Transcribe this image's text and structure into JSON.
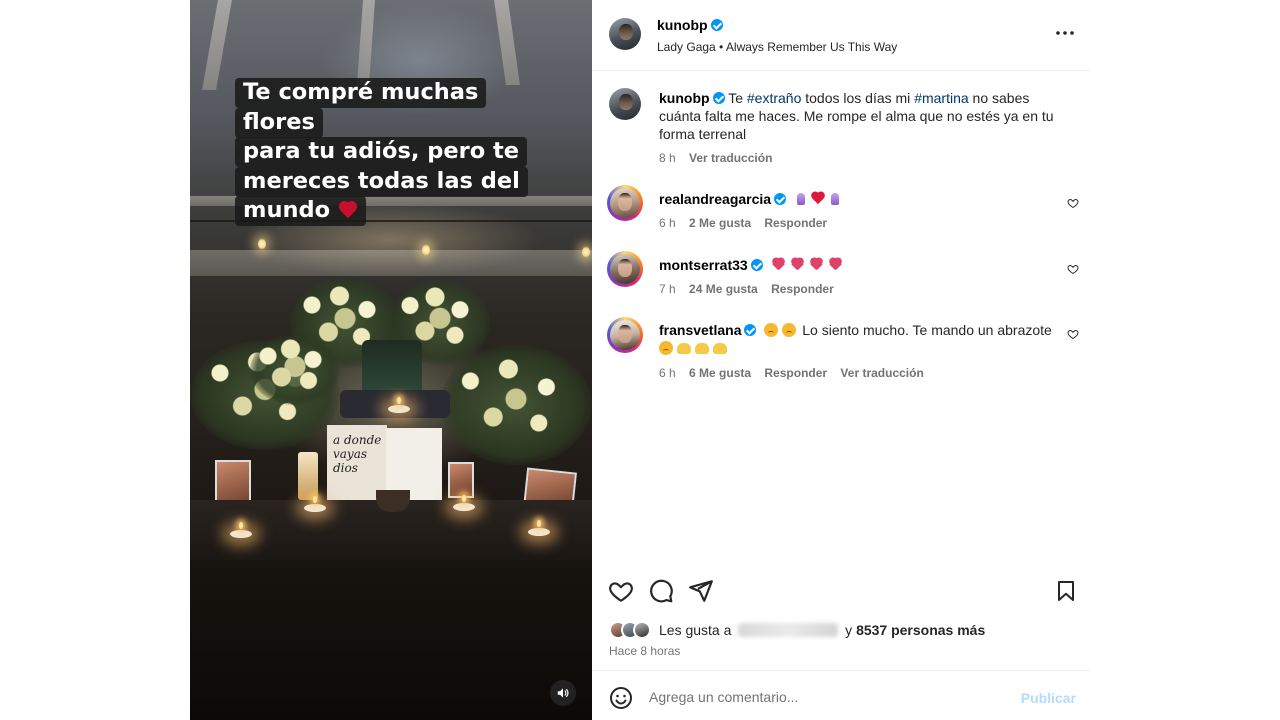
{
  "post": {
    "caption_overlay": {
      "line1": "Te compré muchas flores",
      "line2": "para tu adiós, pero te",
      "line3": "mereces todas las del",
      "line4": "mundo"
    },
    "card_text": "a donde vayas dios"
  },
  "header": {
    "username": "kunobp",
    "audio": "Lady Gaga • Always Remember Us This Way",
    "more_icon": "more-horizontal-icon"
  },
  "caption": {
    "username": "kunobp",
    "text_before_tag1": "Te ",
    "tag1": "#extraño",
    "text_between": " todos los días mi ",
    "tag2": "#martina",
    "text_after": " no sabes cuánta falta me haces. Me rompe el alma que no estés ya en tu forma terrenal",
    "time": "8 h",
    "translate": "Ver traducción"
  },
  "comments": [
    {
      "username": "realandreagarcia",
      "time": "6 h",
      "likes": "2 Me gusta",
      "reply": "Responder"
    },
    {
      "username": "montserrat33",
      "time": "7 h",
      "likes": "24 Me gusta",
      "reply": "Responder"
    },
    {
      "username": "fransvetlana",
      "text": "Lo siento mucho. Te mando un abrazote",
      "time": "6 h",
      "likes": "6 Me gusta",
      "reply": "Responder",
      "translate": "Ver traducción"
    }
  ],
  "likes": {
    "prefix": "Les gusta a",
    "suffix_y": "y",
    "count_text": "8537 personas más",
    "posted": "Hace 8 horas"
  },
  "comment_box": {
    "placeholder": "Agrega un comentario...",
    "post_label": "Publicar"
  },
  "colors": {
    "verified": "#0095f6",
    "hashtag": "#00376b",
    "publish_disabled": "#b3dbff"
  }
}
